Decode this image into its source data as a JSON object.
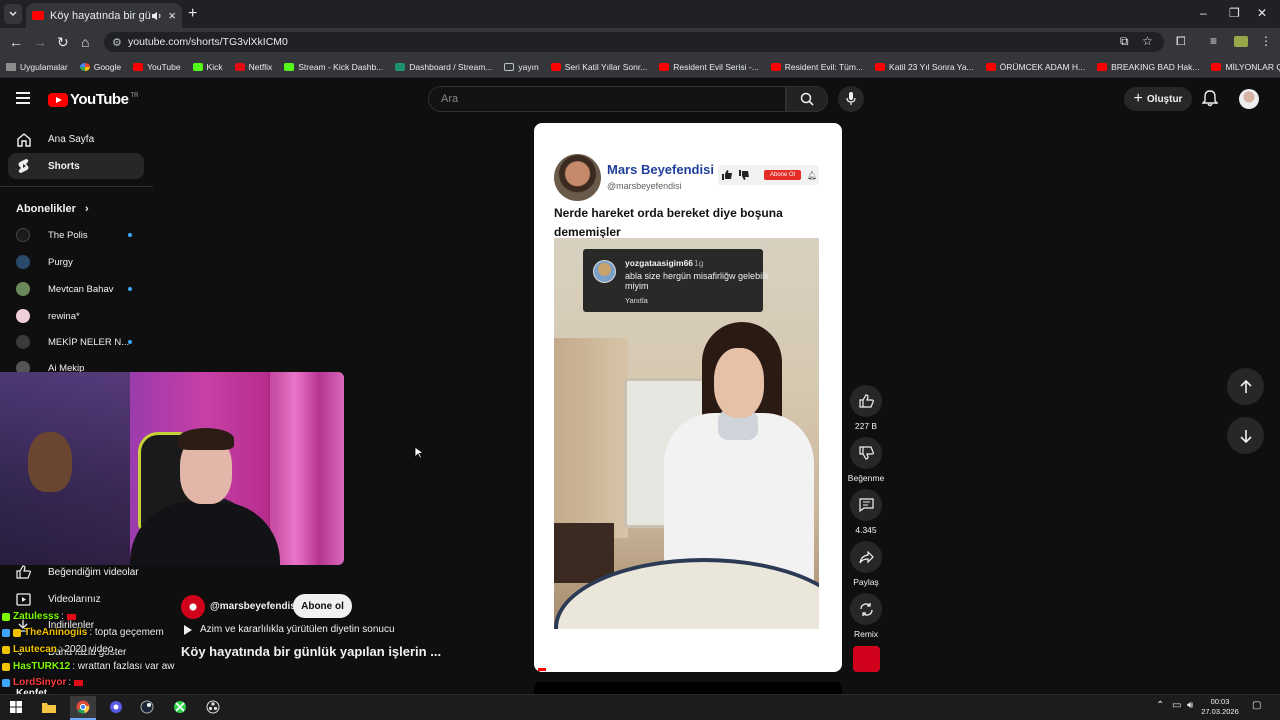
{
  "browser": {
    "tab_title": "Köy hayatında bir günlük ya...",
    "url": "youtube.com/shorts/TG3vlXkICM0",
    "bookmarks": [
      "Uygulamalar",
      "Google",
      "YouTube",
      "Kick",
      "Netflix",
      "Stream - Kick Dashb...",
      "Dashboard / Stream...",
      "yayın",
      "Seri Katil Yıllar Sonr...",
      "Resident Evil Serisi -...",
      "Resident Evil: Tüm...",
      "Katil 23 Yıl Sonra Ya...",
      "ÖRÜMCEK ADAM H...",
      "BREAKING BAD Hak...",
      "MİLYONLAR ÇALAR..."
    ]
  },
  "header": {
    "logo_text": "YouTube",
    "region": "TR",
    "search_placeholder": "Ara",
    "create_label": "Oluştur"
  },
  "sidebar": {
    "home": "Ana Sayfa",
    "shorts": "Shorts",
    "subscriptions_title": "Abonelikler",
    "subscriptions": [
      {
        "name": "The Polis",
        "live_dot": true
      },
      {
        "name": "Purgy",
        "live_dot": false
      },
      {
        "name": "Mevtcan Bahav",
        "live_dot": true
      },
      {
        "name": "rewina*",
        "live_dot": false
      },
      {
        "name": "MEKİP NELER N...",
        "live_dot": true
      },
      {
        "name": "Ai Mekip",
        "live_dot": false
      }
    ],
    "liked": "Beğendiğim videolar",
    "your_videos": "Videolarınız",
    "downloads": "İndirilenler",
    "show_more": "Daha fazla göster"
  },
  "chat": [
    {
      "user": "Zatulesss",
      "text": ":",
      "color": "#7cfc00"
    },
    {
      "user": "TheAninogiis",
      "text": ": topta geçemem",
      "color": "#f2c200"
    },
    {
      "user": "Lautecan",
      "text": ": 2020 video",
      "color": "#f2c200"
    },
    {
      "user": "HasTURK12",
      "text": ": wrattan fazlası var aw",
      "color": "#7cfc00"
    },
    {
      "user": "LordSinyor",
      "text": ":",
      "color": "#ff3b3b"
    },
    {
      "user": "Kenfet",
      "text": "",
      "color": "#f1f1f1"
    }
  ],
  "short": {
    "channel_handle": "@marsbeyefendisi",
    "subscribe_label": "Abone ol",
    "music_text": "Azim ve kararlılıkla yürütülen diyetin sonucu",
    "title": "Köy hayatında bir günlük yapılan işlerin ...",
    "overlay_channel_name": "Mars Beyefendisi",
    "overlay_handle": "@marsbeyefendisi",
    "overlay_subscribe": "Abone Ol",
    "overlay_heading": "Nerde hareket orda bereket diye boşuna dememişler",
    "comment_user": "yozgataasigim66",
    "comment_time": "1g",
    "comment_text": "abla size hergün misafirliğw gelebilir miyim",
    "comment_reply": "Yanıtla"
  },
  "actions": {
    "likes": "227 B",
    "dislike_label": "Beğenme",
    "comments": "4.345",
    "share_label": "Paylaş",
    "remix_label": "Remix"
  },
  "taskbar": {
    "time": "00:03",
    "date": "27.03.2026"
  },
  "colors": {
    "youtube_red": "#ff0000",
    "background": "#0f0f0f",
    "channel_name_blue": "#1f3f9a"
  }
}
